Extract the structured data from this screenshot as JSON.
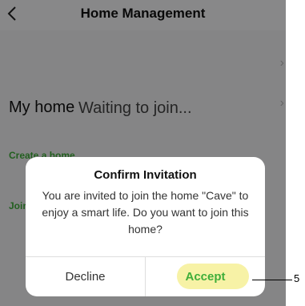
{
  "header": {
    "title": "Home Management",
    "back_icon": "chevron-left-icon"
  },
  "home_list": {
    "my_home_label": "My home",
    "status_text": "Waiting to join...",
    "create_home_label": "Create a home",
    "join_home_label": "Join a home",
    "row_chevron_icon": "chevron-right-icon"
  },
  "dialog": {
    "title": "Confirm Invitation",
    "message": "You are invited to join the home \"Cave\" to enjoy a smart life. Do you want to join this home?",
    "decline_label": "Decline",
    "accept_label": "Accept"
  },
  "annotation": {
    "callout_number": "5"
  },
  "colors": {
    "accent_green": "#3fae3a",
    "highlight_yellow": "#f7f2a6",
    "overlay": "rgba(0,0,0,0.45)"
  }
}
